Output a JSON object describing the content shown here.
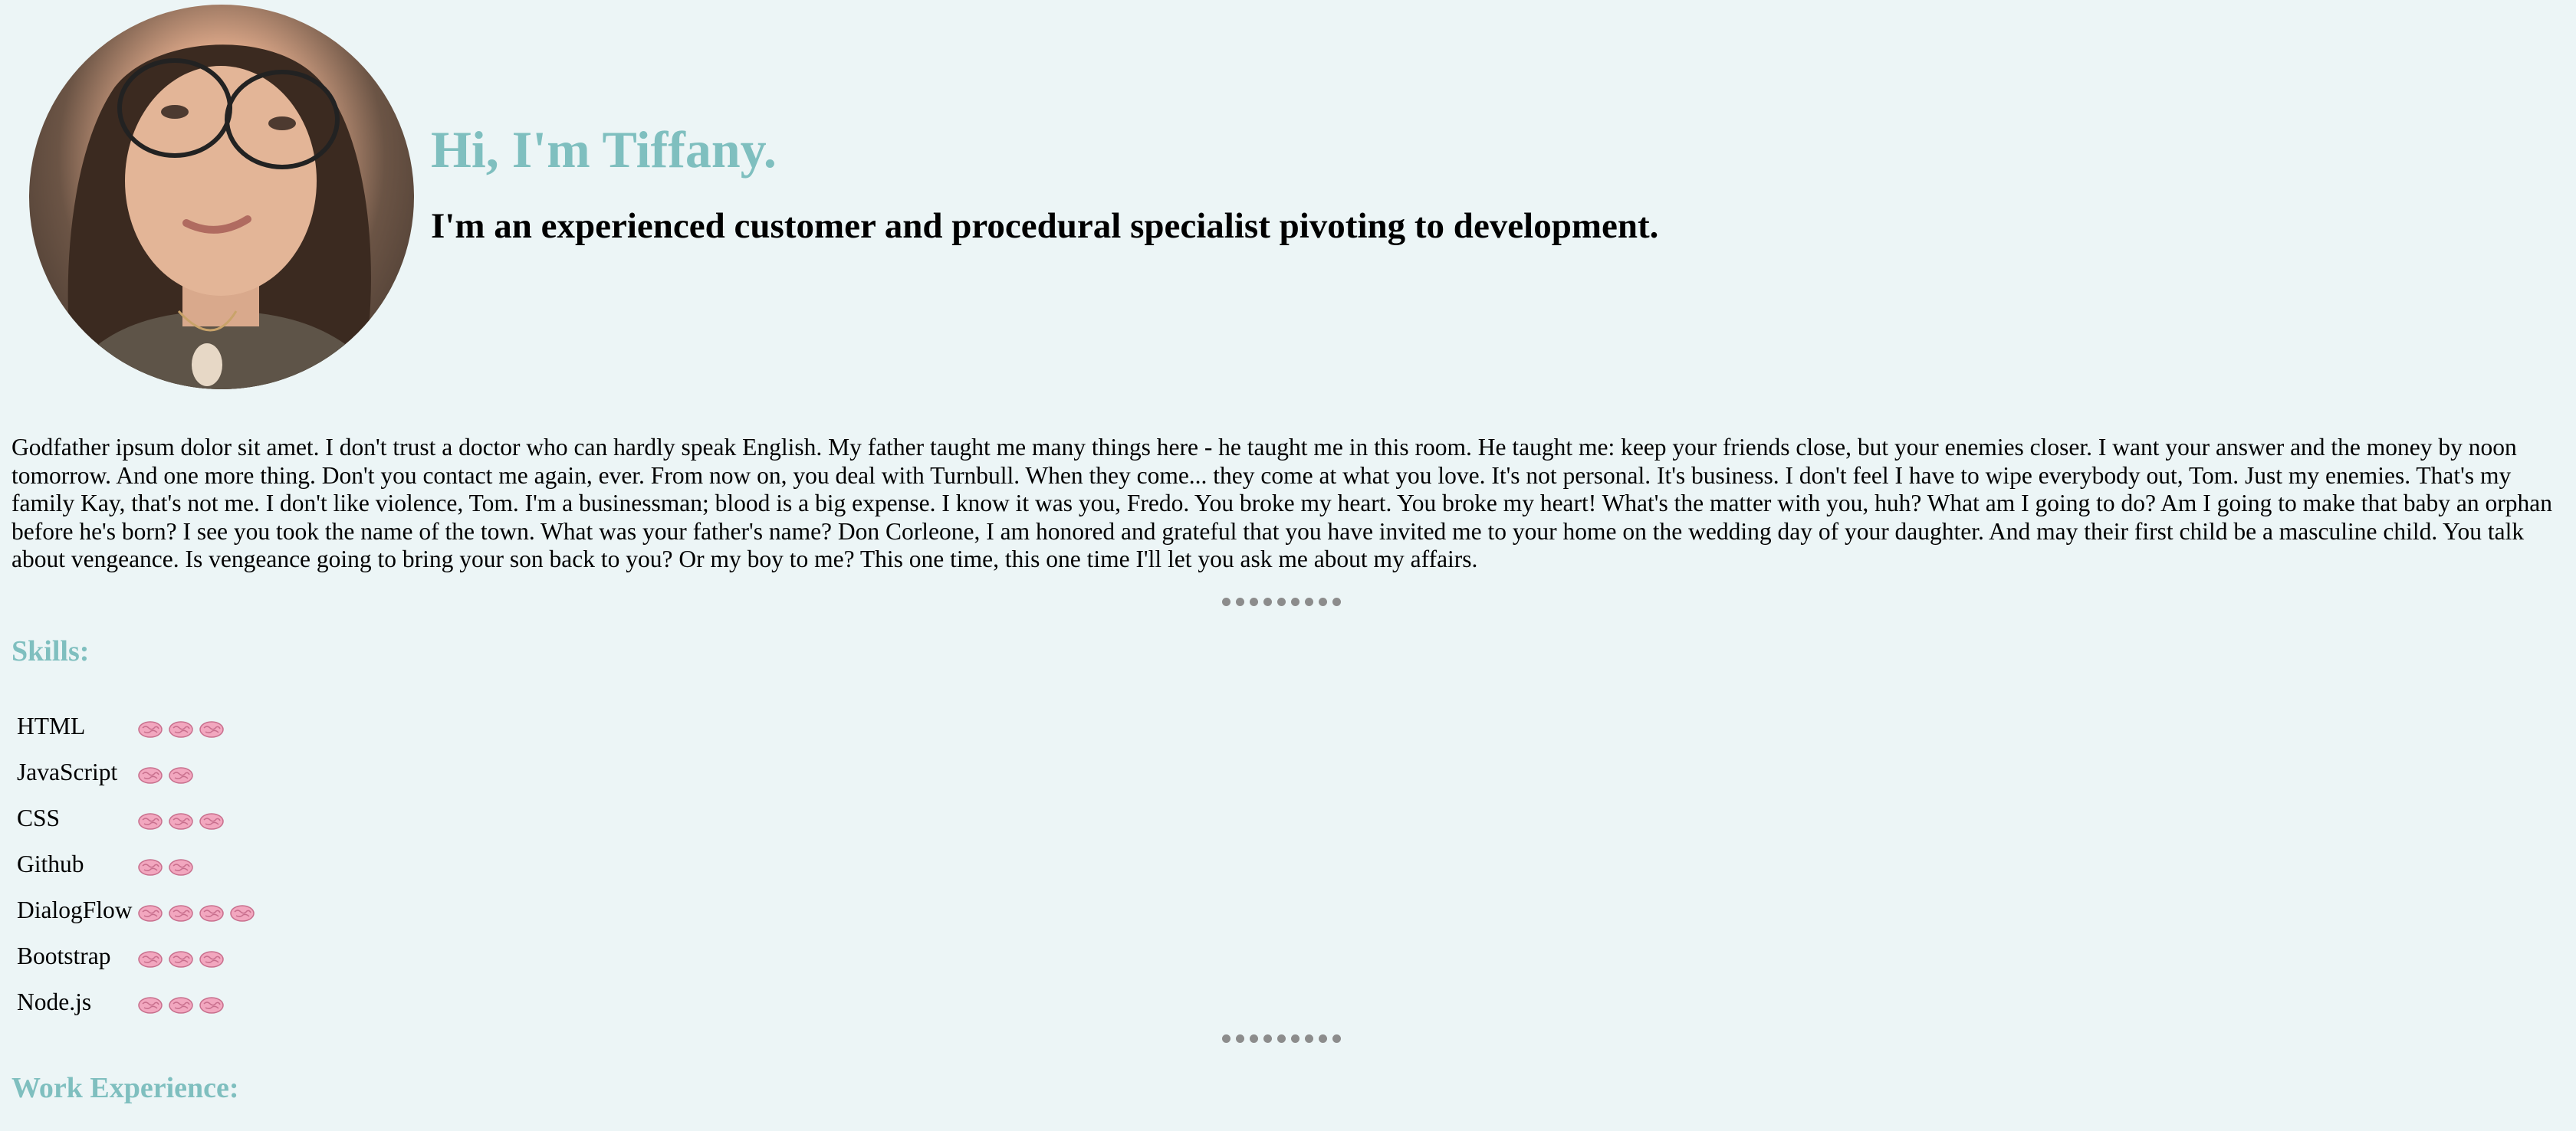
{
  "header": {
    "greeting": "Hi, I'm Tiffany.",
    "tagline": "I'm an experienced customer and procedural specialist pivoting to development.",
    "avatar_icon": "profile-photo"
  },
  "bio": "Godfather ipsum dolor sit amet. I don't trust a doctor who can hardly speak English. My father taught me many things here - he taught me in this room. He taught me: keep your friends close, but your enemies closer. I want your answer and the money by noon tomorrow. And one more thing. Don't you contact me again, ever. From now on, you deal with Turnbull. When they come... they come at what you love. It's not personal. It's business. I don't feel I have to wipe everybody out, Tom. Just my enemies. That's my family Kay, that's not me. I don't like violence, Tom. I'm a businessman; blood is a big expense. I know it was you, Fredo. You broke my heart. You broke my heart! What's the matter with you, huh? What am I going to do? Am I going to make that baby an orphan before he's born? I see you took the name of the town. What was your father's name? Don Corleone, I am honored and grateful that you have invited me to your home on the wedding day of your daughter. And may their first child be a masculine child. You talk about vengeance. Is vengeance going to bring your son back to you? Or my boy to me? This one time, this one time I'll let you ask me about my affairs.",
  "skills_section": {
    "title": "Skills:",
    "rating_icon": "brain-icon",
    "items": [
      {
        "name": "HTML",
        "level": 3
      },
      {
        "name": "JavaScript",
        "level": 2
      },
      {
        "name": "CSS",
        "level": 3
      },
      {
        "name": "Github",
        "level": 2
      },
      {
        "name": "DialogFlow",
        "level": 4
      },
      {
        "name": "Bootstrap",
        "level": 3
      },
      {
        "name": "Node.js",
        "level": 3
      }
    ]
  },
  "work_section": {
    "title": "Work Experience:"
  },
  "colors": {
    "background": "#ecf5f6",
    "accent": "#7fbfbf",
    "divider": "#8c8c8c",
    "brain": "#f2a7bf"
  }
}
